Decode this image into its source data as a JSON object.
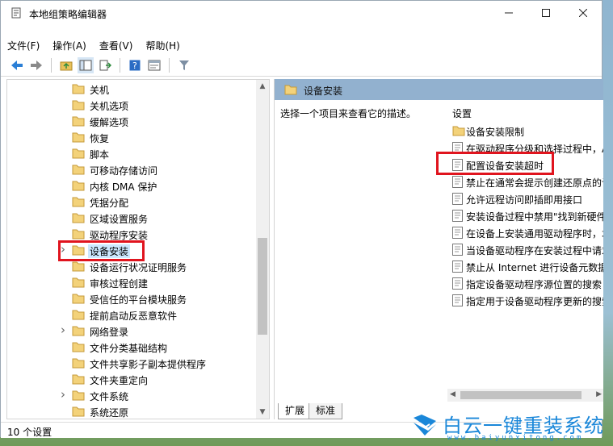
{
  "window": {
    "title": "本地组策略编辑器"
  },
  "menu": [
    "文件(F)",
    "操作(A)",
    "查看(V)",
    "帮助(H)"
  ],
  "toolbar": [
    "back-icon",
    "forward-icon",
    "up-folder-icon",
    "show-tree-icon",
    "export-icon",
    "help-icon",
    "properties-icon",
    "filter-icon"
  ],
  "tree": {
    "items": [
      {
        "label": "关机",
        "expandable": false
      },
      {
        "label": "关机选项",
        "expandable": false
      },
      {
        "label": "缓解选项",
        "expandable": false
      },
      {
        "label": "恢复",
        "expandable": false
      },
      {
        "label": "脚本",
        "expandable": false
      },
      {
        "label": "可移动存储访问",
        "expandable": false
      },
      {
        "label": "内核 DMA 保护",
        "expandable": false
      },
      {
        "label": "凭据分配",
        "expandable": false
      },
      {
        "label": "区域设置服务",
        "expandable": false
      },
      {
        "label": "驱动程序安装",
        "expandable": false
      },
      {
        "label": "设备安装",
        "expandable": true,
        "selected": true
      },
      {
        "label": "设备运行状况证明服务",
        "expandable": false
      },
      {
        "label": "审核过程创建",
        "expandable": false
      },
      {
        "label": "受信任的平台模块服务",
        "expandable": false
      },
      {
        "label": "提前启动反恶意软件",
        "expandable": false
      },
      {
        "label": "网络登录",
        "expandable": true
      },
      {
        "label": "文件分类基础结构",
        "expandable": false
      },
      {
        "label": "文件共享影子副本提供程序",
        "expandable": false
      },
      {
        "label": "文件夹重定向",
        "expandable": false
      },
      {
        "label": "文件系统",
        "expandable": true
      },
      {
        "label": "系统还原",
        "expandable": false
      }
    ]
  },
  "right": {
    "header": "设备安装",
    "description": "选择一个项目来查看它的描述。",
    "settings_header": "设置",
    "settings": [
      {
        "label": "设备安装限制",
        "kind": "folder"
      },
      {
        "label": "在驱动程序分级和选择过程中，A",
        "kind": "policy"
      },
      {
        "label": "配置设备安装超时",
        "kind": "policy"
      },
      {
        "label": "禁止在通常会提示创建还原点的讠",
        "kind": "policy"
      },
      {
        "label": "允许远程访问即插即用接口",
        "kind": "policy"
      },
      {
        "label": "安装设备过程中禁用\"找到新硬件",
        "kind": "policy"
      },
      {
        "label": "在设备上安装通用驱动程序时，才",
        "kind": "policy"
      },
      {
        "label": "当设备驱动程序在安装过程中请求",
        "kind": "policy"
      },
      {
        "label": "禁止从 Internet 进行设备元数据",
        "kind": "policy"
      },
      {
        "label": "指定设备驱动程序源位置的搜索",
        "kind": "policy"
      },
      {
        "label": "指定用于设备驱动程序更新的搜索",
        "kind": "policy"
      }
    ],
    "tabs": [
      "扩展",
      "标准"
    ]
  },
  "status": "10 个设置",
  "watermark": {
    "text": "白云一键重装系统",
    "url": "www.baiyunxitong.com"
  },
  "colors": {
    "highlight": "#e0141e",
    "header_bg": "#92b1cf",
    "folder": "#e8c15a",
    "selection": "#cce8ff"
  }
}
